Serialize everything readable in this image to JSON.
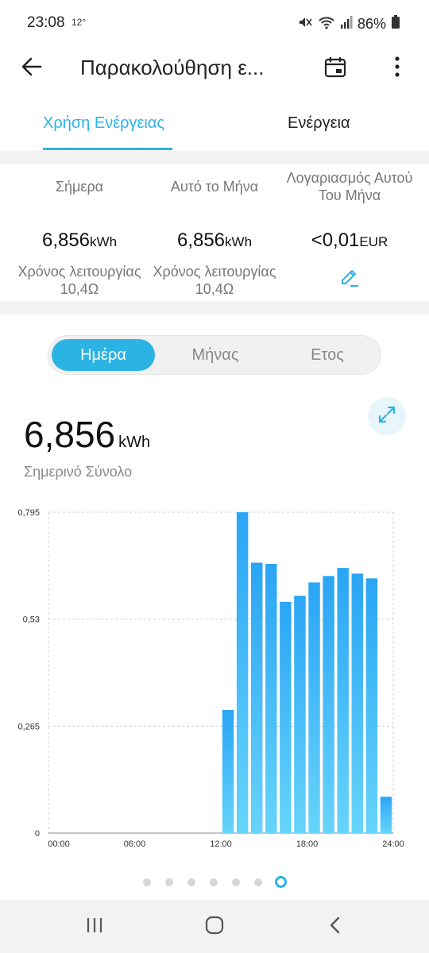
{
  "status_bar": {
    "time": "23:08",
    "temperature": "12°",
    "battery": "86%",
    "icons": [
      "mute-icon",
      "wifi-icon",
      "signal-icon",
      "battery-icon"
    ]
  },
  "app_bar": {
    "title": "Παρακολούθηση ε...",
    "icons": [
      "back-arrow-icon",
      "calendar-icon",
      "more-vert-icon"
    ]
  },
  "tabs": [
    {
      "label": "Χρήση Ενέργειας",
      "active": true
    },
    {
      "label": "Ενέργεια",
      "active": false
    }
  ],
  "summary": {
    "today": {
      "label": "Σήμερα",
      "value": "6,856",
      "unit": "kWh",
      "sub": "Χρόνος λειτουργίας 10,4Ω"
    },
    "month": {
      "label": "Αυτό το Μήνα",
      "value": "6,856",
      "unit": "kWh",
      "sub": "Χρόνος λειτουργίας 10,4Ω"
    },
    "bill": {
      "label": "Λογαριασμός Αυτού Του Μήνα",
      "value": "<0,01",
      "unit": "EUR",
      "icon": "edit-pencil-icon"
    }
  },
  "period_selector": {
    "options": [
      "Ημέρα",
      "Μήνας",
      "Ετος"
    ],
    "selected": "Ημέρα"
  },
  "total": {
    "value": "6,856",
    "unit": "kWh",
    "label": "Σημερινό Σύνολο",
    "expand_icon": "expand-icon"
  },
  "chart_data": {
    "type": "bar",
    "x": [
      0.5,
      1.5,
      2.5,
      3.5,
      4.5,
      5.5,
      6.5,
      7.5,
      8.5,
      9.5,
      10.5,
      11.5,
      12.5,
      13.5,
      14.5,
      15.5,
      16.5,
      17.5,
      18.5,
      19.5,
      20.5,
      21.5,
      22.5,
      23.5
    ],
    "values": [
      0,
      0,
      0,
      0,
      0,
      0,
      0,
      0,
      0,
      0,
      0,
      0,
      0.305,
      0.795,
      0.67,
      0.667,
      0.573,
      0.588,
      0.621,
      0.637,
      0.657,
      0.643,
      0.631,
      0.09
    ],
    "xlim": [
      0,
      24
    ],
    "ylim": [
      0,
      0.795
    ],
    "x_ticks": [
      "00:00",
      "06:00",
      "12:00",
      "18:00",
      "24:00"
    ],
    "x_tick_values": [
      0,
      6,
      12,
      18,
      24
    ],
    "y_ticks": [
      "0",
      "0,265",
      "0,53",
      "0,795"
    ],
    "y_tick_values": [
      0,
      0.265,
      0.53,
      0.795
    ],
    "grid": true,
    "colors": {
      "bar_top": "#2aa5f5",
      "bar_bottom": "#66d4fa",
      "grid": "#cfcfcf"
    }
  },
  "pagination": {
    "count": 7,
    "active_index": 6
  },
  "nav_bar": {
    "icons": [
      "recent-apps-icon",
      "home-icon",
      "back-nav-icon"
    ]
  },
  "colors": {
    "accent": "#2bb3e3",
    "background": "#ffffff",
    "separator": "#f2f2f2"
  }
}
